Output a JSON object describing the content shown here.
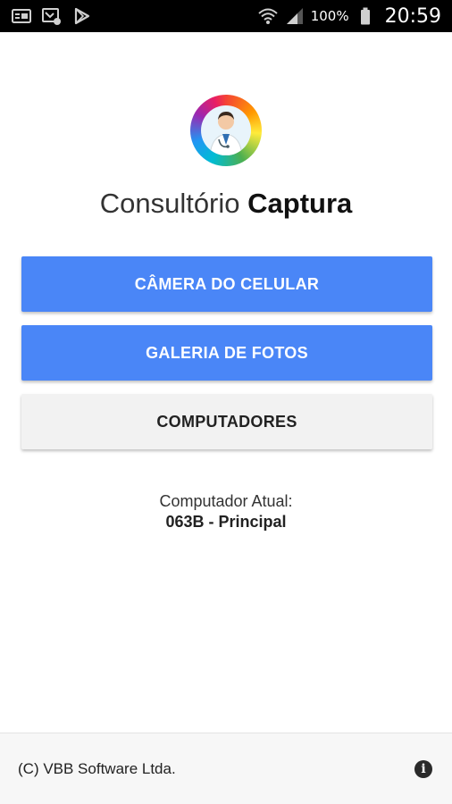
{
  "status_bar": {
    "icons_left": [
      "mail-icon",
      "screenshot-icon",
      "play-store-icon"
    ],
    "icons_right": [
      "wifi-icon",
      "signal-icon"
    ],
    "battery": "100%",
    "time": "20:59"
  },
  "app": {
    "title_light": "Consultório",
    "title_bold": "Captura",
    "logo_icon": "doctor-icon"
  },
  "buttons": {
    "camera": "CÂMERA DO CELULAR",
    "gallery": "GALERIA DE FOTOS",
    "computers": "COMPUTADORES"
  },
  "current_computer": {
    "label": "Computador Atual:",
    "value": "063B - Principal"
  },
  "footer": {
    "copyright": "(C) VBB Software Ltda.",
    "info_icon": "info-icon"
  },
  "colors": {
    "primary": "#4a86f7",
    "secondary": "#f2f2f2",
    "status_bar": "#000000"
  }
}
